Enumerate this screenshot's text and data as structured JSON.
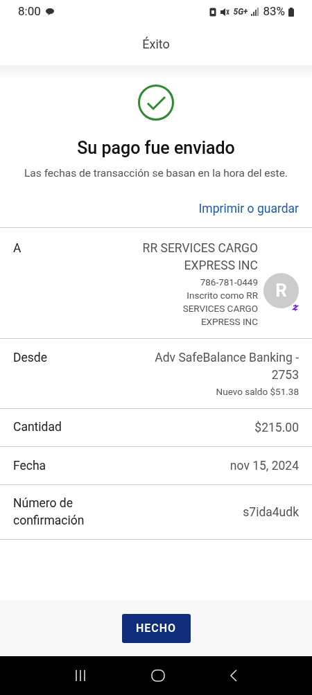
{
  "status_bar": {
    "time": "8:00",
    "network": "5G+",
    "battery": "83%"
  },
  "header": {
    "title": "Éxito"
  },
  "confirmation": {
    "title": "Su pago fue enviado",
    "message": "Las fechas de transacción se basan en la hora del este.",
    "link": "Imprimir o guardar"
  },
  "details": [
    {
      "kind": "recipient",
      "label": "A",
      "value": "RR SERVICES CARGO EXPRESS INC",
      "phone": "786-781-0449",
      "note": "Inscrito como RR SERVICES CARGO EXPRESS INC",
      "avatar": "R"
    },
    {
      "kind": "account",
      "label": "Desde",
      "value": "Adv SafeBalance Banking - 2753",
      "note": "Nuevo saldo $51.38"
    },
    {
      "kind": "plain",
      "label": "Cantidad",
      "value": "$215.00"
    },
    {
      "kind": "plain",
      "label": "Fecha",
      "value": "nov 15, 2024"
    },
    {
      "kind": "plain",
      "label": "Número de confirmación",
      "value": "s7ida4udk"
    }
  ],
  "button": "HECHO"
}
